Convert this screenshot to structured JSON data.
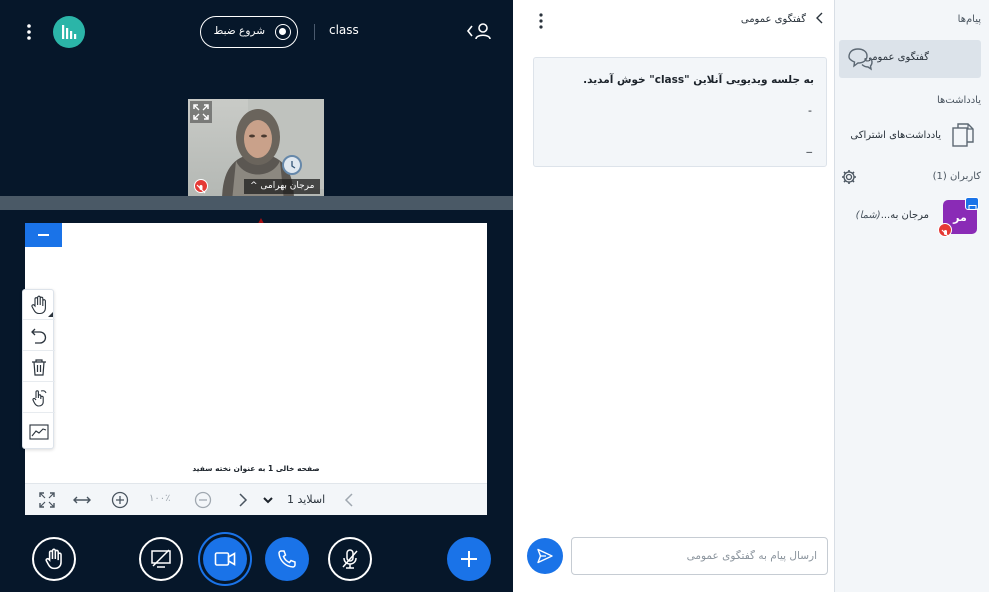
{
  "topbar": {
    "recording_label": "شروع ضبط",
    "meeting_name": "class"
  },
  "video": {
    "user_name": "مرجان بهرامی"
  },
  "presentation": {
    "caption": "صفحه خالی 1 به عنوان نخته سفید",
    "slide_label": "اسلاید 1",
    "zoom_label": "۱۰۰٪"
  },
  "chat": {
    "title": "گفتگوی عمومی",
    "welcome_line": "به جلسه ویدیویی آنلاین \"class\" خوش آمدید.",
    "line2": "-",
    "line3": "_",
    "input_placeholder": "ارسال پیام به گفتگوی عمومی"
  },
  "sidebar": {
    "messages_header": "پیام‌ها",
    "public_chat_label": "گفتگوی عمومی",
    "notes_header": "یادداشت‌ها",
    "shared_notes_label": "یادداشت‌های اشتراکی",
    "users_header": "کاربران (1)",
    "user_initials": "مر",
    "user_name": "مرجان به...",
    "user_you": "(شما)"
  },
  "colors": {
    "brand_blue": "#1A73E8",
    "dark_bg": "#06172A",
    "arrow_red": "#A30E12",
    "avatar_purple": "#8A2BB6"
  }
}
